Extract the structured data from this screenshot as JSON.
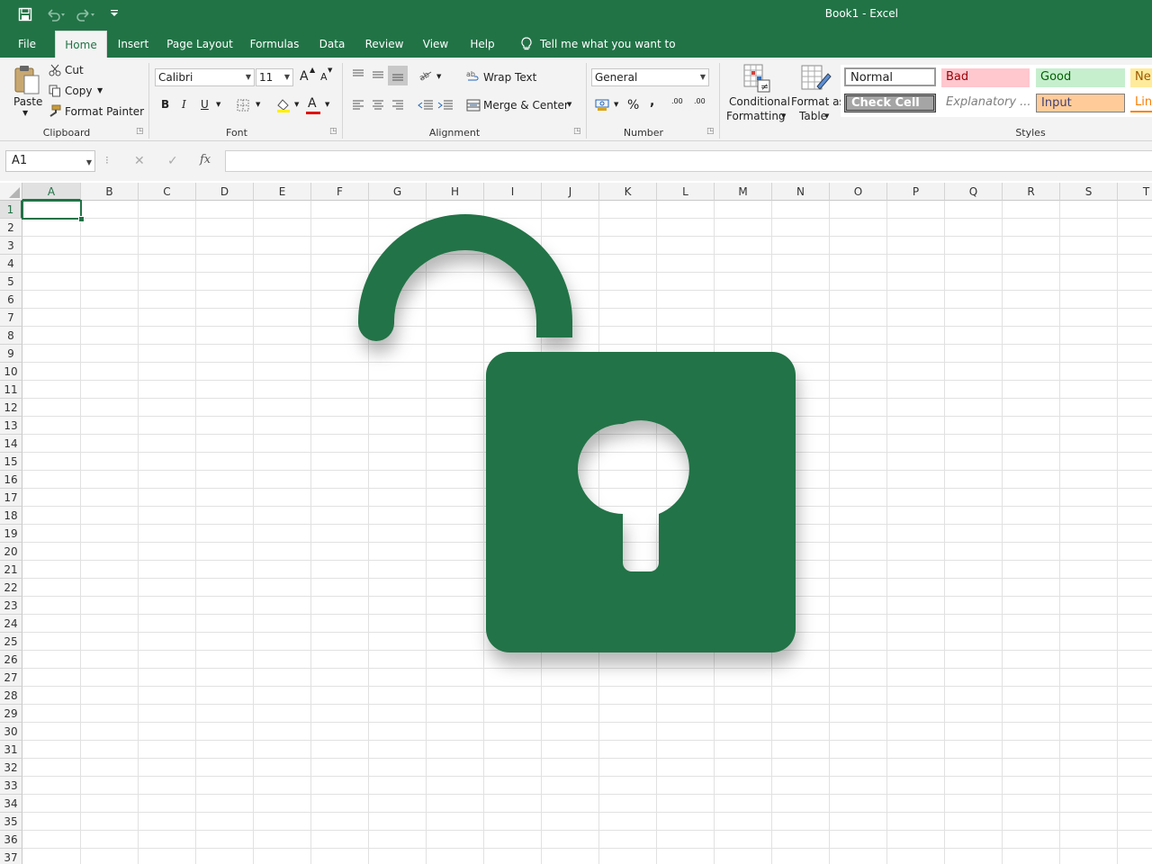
{
  "window": {
    "title": "Book1  -  Excel"
  },
  "quick_access": {
    "save_icon": "save-icon",
    "undo_icon": "undo-icon",
    "redo_icon": "redo-icon",
    "customize_icon": "chevron-down-icon"
  },
  "tabs": [
    {
      "label": "File"
    },
    {
      "label": "Home"
    },
    {
      "label": "Insert"
    },
    {
      "label": "Page Layout"
    },
    {
      "label": "Formulas"
    },
    {
      "label": "Data"
    },
    {
      "label": "Review"
    },
    {
      "label": "View"
    },
    {
      "label": "Help"
    }
  ],
  "active_tab": "Home",
  "tell_me": "Tell me what you want to do",
  "clipboard": {
    "paste": "Paste",
    "cut": "Cut",
    "copy": "Copy",
    "format_painter": "Format Painter",
    "label": "Clipboard"
  },
  "font": {
    "name": "Calibri",
    "size": "11",
    "bold": "B",
    "italic": "I",
    "underline": "U",
    "label": "Font",
    "inc": "A",
    "dec": "A",
    "font_color": "A"
  },
  "alignment": {
    "wrap": "Wrap Text",
    "merge": "Merge & Center",
    "label": "Alignment"
  },
  "number": {
    "format": "General",
    "percent": "%",
    "comma": ",",
    "inc_decimal": ".00",
    "dec_decimal": ".00",
    "label": "Number"
  },
  "styles": {
    "conditional_1": "Conditional",
    "conditional_2": "Formatting",
    "format_table_1": "Format as",
    "format_table_2": "Table",
    "normal": "Normal",
    "bad": "Bad",
    "good": "Good",
    "neutral": "Ne",
    "check_cell": "Check Cell",
    "explanatory": "Explanatory ...",
    "input": "Input",
    "linked": "Lin",
    "label": "Styles"
  },
  "formula_bar": {
    "name_box": "A1",
    "cancel": "✕",
    "enter": "✓",
    "fx": "fx",
    "value": ""
  },
  "columns": [
    "A",
    "B",
    "C",
    "D",
    "E",
    "F",
    "G",
    "H",
    "I",
    "J",
    "K",
    "L",
    "M",
    "N",
    "O",
    "P",
    "Q",
    "R",
    "S",
    "T"
  ],
  "rows": [
    "1",
    "2",
    "3",
    "4",
    "5",
    "6",
    "7",
    "8",
    "9",
    "10",
    "11",
    "12",
    "13",
    "14",
    "15",
    "16",
    "17",
    "18",
    "19",
    "20",
    "21",
    "22",
    "23",
    "24",
    "25",
    "26",
    "27",
    "28",
    "29",
    "30",
    "31",
    "32",
    "33",
    "34",
    "35",
    "36",
    "37"
  ],
  "selected_cell": "A1",
  "overlay": {
    "icon": "unlock-icon",
    "color": "#217346"
  },
  "colors": {
    "accent": "#217346"
  }
}
